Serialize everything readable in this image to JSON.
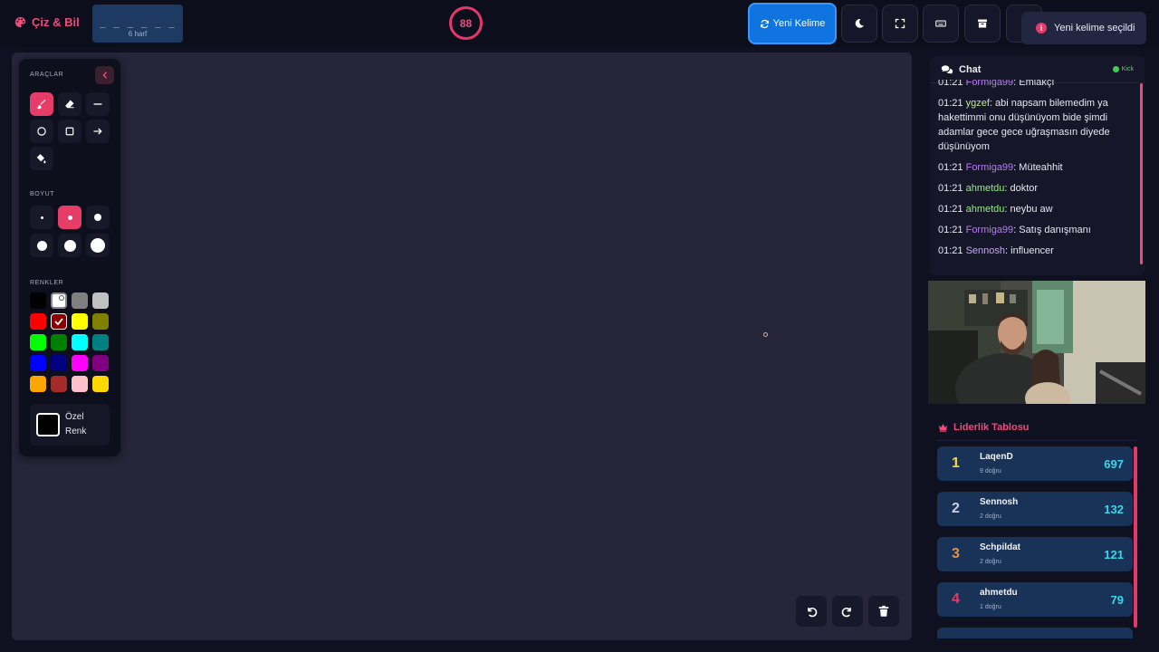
{
  "app": {
    "title": "Çiz & Bil"
  },
  "word": {
    "mask": "_ _ _ _ _ _",
    "length_label": "6 harf"
  },
  "timer": {
    "value": "88"
  },
  "toolbar": {
    "new_word_label": "Yeni Kelime"
  },
  "toast": {
    "message": "Yeni kelime seçildi"
  },
  "tools_panel": {
    "section_tools": "ARAÇLAR",
    "section_size": "BOYUT",
    "section_colors": "RENKLER",
    "tools": [
      "brush-icon",
      "eraser-icon",
      "line-icon",
      "circle-icon",
      "square-icon",
      "arrow-icon",
      "bucket-icon"
    ],
    "active_tool": "brush",
    "active_size_index": 1,
    "selected_color": "#8b0000",
    "colors": [
      "#000000",
      "#ffffff",
      "#808080",
      "#c0c0c0",
      "#ff0000",
      "#8b0000",
      "#ffff00",
      "#808000",
      "#00ff00",
      "#008000",
      "#00ffff",
      "#008080",
      "#0000ff",
      "#000080",
      "#ff00ff",
      "#800080",
      "#ffa500",
      "#a52a2a",
      "#ffc0cb",
      "#ffd700"
    ],
    "custom_color_label": "Özel Renk"
  },
  "chat": {
    "title": "Chat",
    "status": "Kick",
    "messages": [
      {
        "time": "01:21",
        "user": "Formiga99",
        "text": ": Emlakçı"
      },
      {
        "time": "01:21",
        "user": "ygzef",
        "text": ": abi napsam bilemedim ya hakettimmi onu düşünüyom bide şimdi adamlar gece gece uğraşmasın diyede düşünüyom"
      },
      {
        "time": "01:21",
        "user": "Formiga99",
        "text": ": Müteahhit"
      },
      {
        "time": "01:21",
        "user": "ahmetdu",
        "text": ": doktor"
      },
      {
        "time": "01:21",
        "user": "ahmetdu",
        "text": ": neybu aw"
      },
      {
        "time": "01:21",
        "user": "Formiga99",
        "text": ": Satış danışmanı"
      },
      {
        "time": "01:21",
        "user": "Sennosh",
        "text": ": influencer"
      }
    ]
  },
  "leaderboard": {
    "title": "Liderlik Tablosu",
    "entries": [
      {
        "rank": "1",
        "name": "LaqenD",
        "correct": "9 doğru",
        "score": "697",
        "rank_color": "#f5d742"
      },
      {
        "rank": "2",
        "name": "Sennosh",
        "correct": "2 doğru",
        "score": "132",
        "rank_color": "#c8d0dc"
      },
      {
        "rank": "3",
        "name": "Schpildat",
        "correct": "2 doğru",
        "score": "121",
        "rank_color": "#e0914a"
      },
      {
        "rank": "4",
        "name": "ahmetdu",
        "correct": "1 doğru",
        "score": "79",
        "rank_color": "#e7366a"
      }
    ]
  }
}
